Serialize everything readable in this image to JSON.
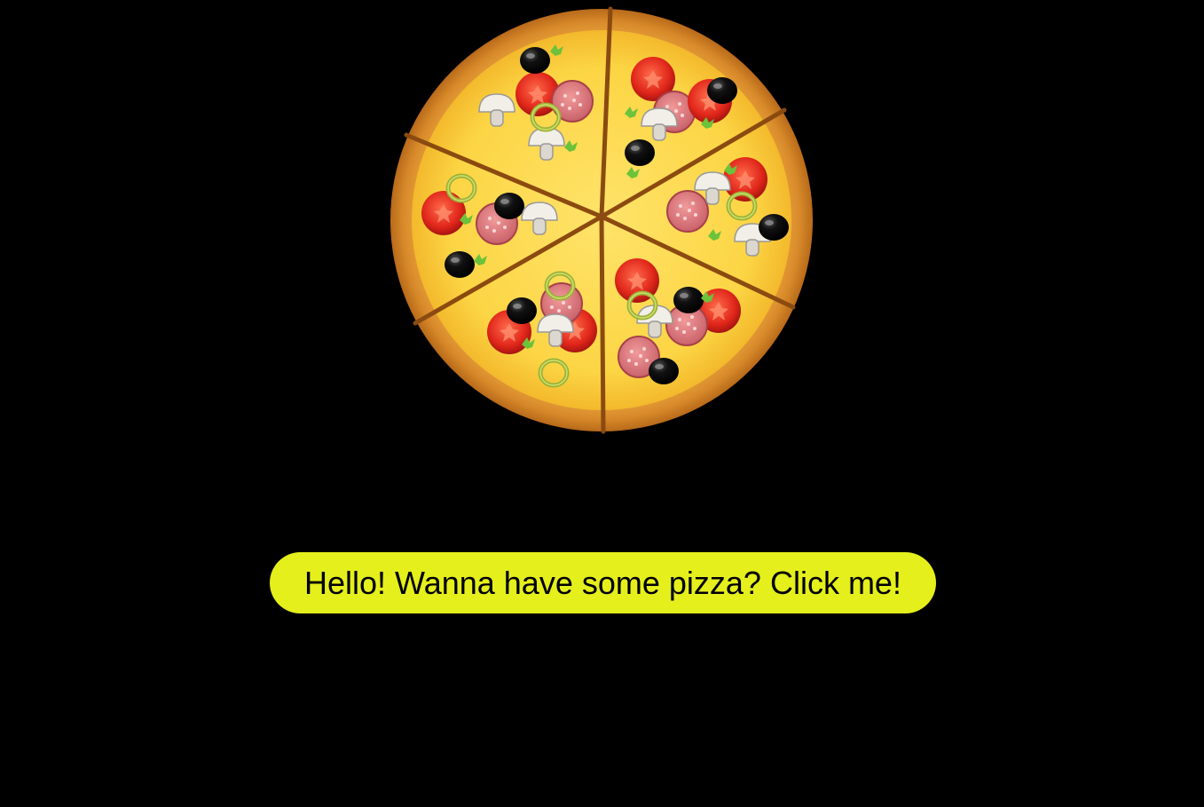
{
  "page": {
    "background_color": "#000000"
  },
  "hero": {
    "image_icon": "pizza-icon"
  },
  "cta": {
    "label": "Hello! Wanna have some pizza? Click me!",
    "background_color": "#e5ef1c",
    "text_color": "#000000"
  }
}
